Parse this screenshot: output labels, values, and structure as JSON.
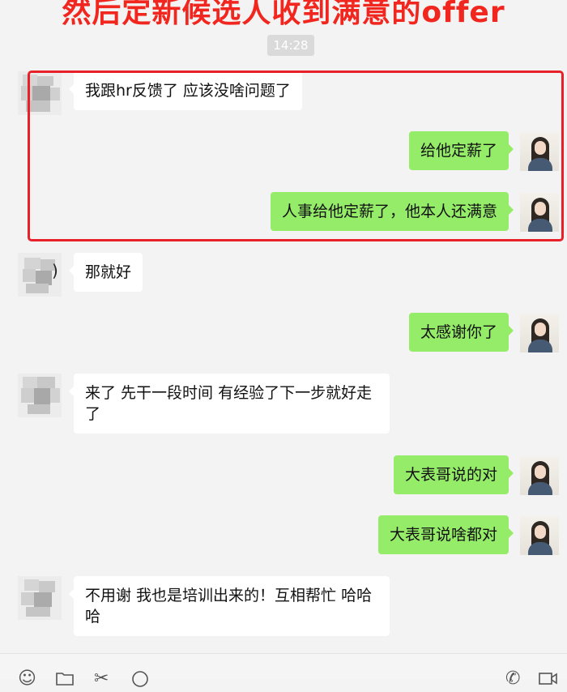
{
  "caption": "然后定新候选人收到满意的offer",
  "timestamp": "14:28",
  "messages": [
    {
      "side": "left",
      "text": "我跟hr反馈了 应该没啥问题了"
    },
    {
      "side": "right",
      "text": "给他定薪了"
    },
    {
      "side": "right",
      "text": "人事给他定薪了，他本人还满意"
    },
    {
      "side": "left",
      "text": "那就好"
    },
    {
      "side": "right",
      "text": "太感谢你了"
    },
    {
      "side": "left",
      "text": "来了 先干一段时间 有经验了下一步就好走了"
    },
    {
      "side": "right",
      "text": "大表哥说的对"
    },
    {
      "side": "right",
      "text": "大表哥说啥都对"
    },
    {
      "side": "left",
      "text": "不用谢 我也是培训出来的！互相帮忙 哈哈哈"
    }
  ],
  "partial_glyph": ")",
  "toolbar_icons": [
    "emoji-icon",
    "folder-icon",
    "scissors-icon",
    "chat-icon",
    "call-icon",
    "video-icon"
  ],
  "colors": {
    "caption": "#f0261f",
    "self_bubble": "#95ec69",
    "other_bubble": "#ffffff",
    "highlight": "#e8202a",
    "background": "#f3f3f3"
  }
}
